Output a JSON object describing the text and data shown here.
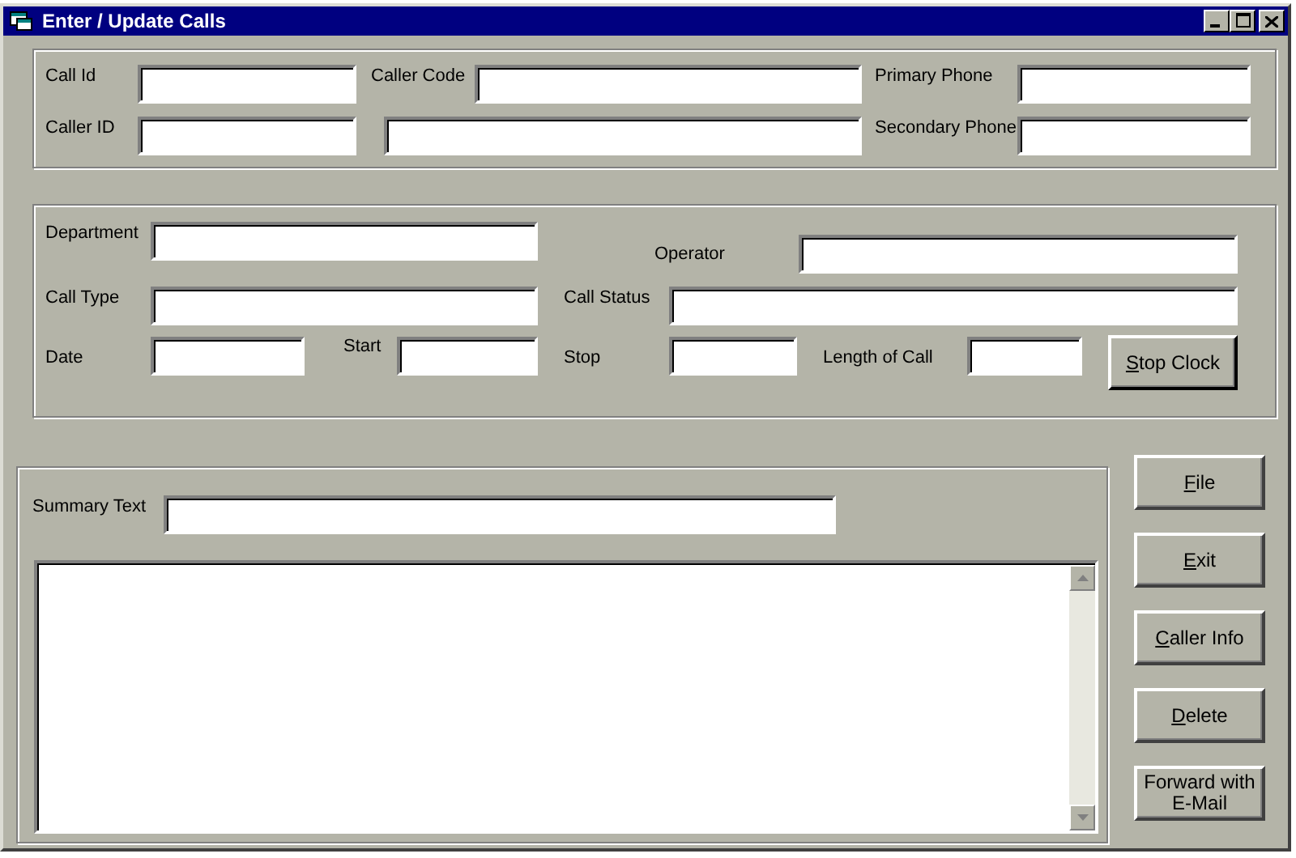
{
  "window": {
    "title": "Enter / Update Calls"
  },
  "caller_group": {
    "controls": [
      {
        "kind": "field",
        "label": "Call Id"
      },
      {
        "kind": "field",
        "label": "Caller Code"
      },
      {
        "kind": "field",
        "label": "Primary Phone"
      },
      {
        "kind": "field",
        "label": "Caller ID"
      },
      {
        "kind": "field"
      },
      {
        "kind": "field",
        "label": "Secondary Phone"
      }
    ]
  },
  "call_group": {
    "controls": [
      {
        "kind": "field",
        "label": "Department"
      },
      {
        "kind": "field",
        "label": "Operator"
      },
      {
        "kind": "field",
        "label": "Call Type"
      },
      {
        "kind": "field",
        "label": "Call Status"
      },
      {
        "kind": "field",
        "label": "Date"
      },
      {
        "kind": "field",
        "label": "Start"
      },
      {
        "kind": "field",
        "label": "Stop"
      },
      {
        "kind": "field",
        "label": "Length of Call"
      },
      {
        "kind": "button",
        "label": "Stop Clock",
        "mnemonic": true
      }
    ]
  },
  "summary": {
    "label": "Summary Text"
  },
  "buttons": [
    {
      "label": "File",
      "mnemonic": true
    },
    {
      "label": "Exit",
      "mnemonic": true
    },
    {
      "label": "Caller Info",
      "mnemonic": true
    },
    {
      "label": "Delete",
      "mnemonic": true
    },
    {
      "label": "Forward with E-Mail",
      "mnemonic": false
    }
  ]
}
